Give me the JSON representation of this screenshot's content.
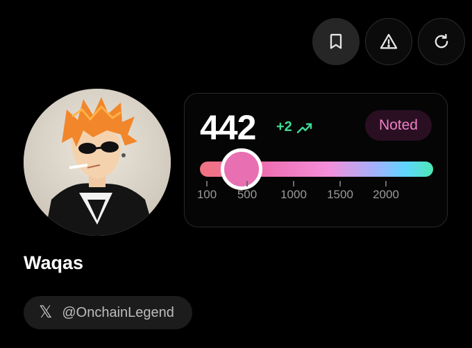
{
  "actions": [
    {
      "name": "bookmark",
      "icon": "bookmark-icon",
      "active": true
    },
    {
      "name": "report",
      "icon": "warning-icon",
      "active": false
    },
    {
      "name": "refresh",
      "icon": "refresh-icon",
      "active": false
    }
  ],
  "profile": {
    "name": "Waqas",
    "handle": "@OnchainLegend",
    "social_icon": "x-icon",
    "avatar": "anime-avatar-orange-hair-sunglasses"
  },
  "score": {
    "value": "442",
    "delta": "+2",
    "trend_icon": "trending-up-icon",
    "status": "Noted",
    "slider": {
      "value": 442,
      "ticks": [
        "100",
        "500",
        "1000",
        "1500",
        "2000"
      ]
    },
    "colors": {
      "delta": "#3ddc97",
      "status_text": "#f07fc7",
      "status_bg": "#2a0f22",
      "thumb": "#e76fb2"
    }
  }
}
